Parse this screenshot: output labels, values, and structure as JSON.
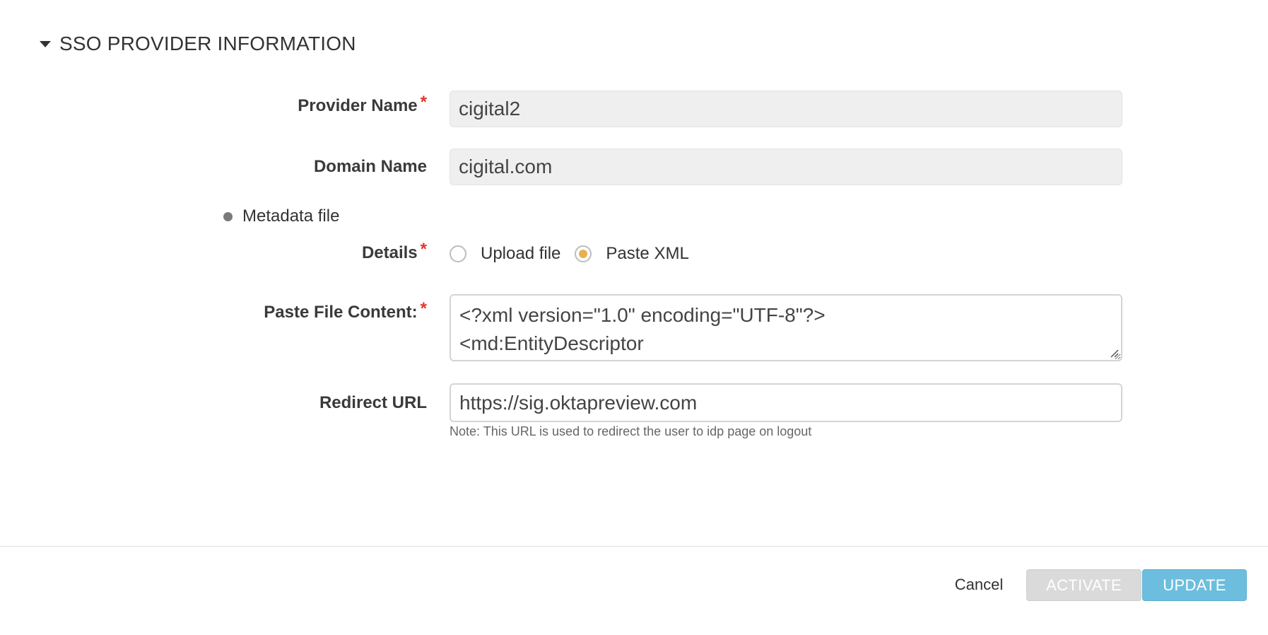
{
  "section": {
    "title": "SSO PROVIDER INFORMATION"
  },
  "form": {
    "provider_name": {
      "label": "Provider Name",
      "value": "cigital2"
    },
    "domain_name": {
      "label": "Domain Name",
      "value": "cigital.com"
    },
    "metadata": {
      "label": "Metadata file"
    },
    "details": {
      "label": "Details",
      "options": [
        {
          "label": "Upload file",
          "selected": false
        },
        {
          "label": "Paste XML",
          "selected": true
        }
      ]
    },
    "paste_content": {
      "label": "Paste File Content:",
      "lines": [
        "<?xml version=\"1.0\" encoding=\"UTF-8\"?>",
        "<md:EntityDescriptor"
      ]
    },
    "redirect_url": {
      "label": "Redirect URL",
      "value": "https://sig.oktapreview.com",
      "note": "Note: This URL is used to redirect the user to idp page on logout"
    }
  },
  "footer": {
    "cancel_label": "Cancel",
    "activate_label": "ACTIVATE",
    "update_label": "UPDATE"
  },
  "colors": {
    "required_star": "#e2372f",
    "radio_selected": "#e8b04c",
    "update_button": "#6dbede",
    "activate_button": "#dadada"
  }
}
